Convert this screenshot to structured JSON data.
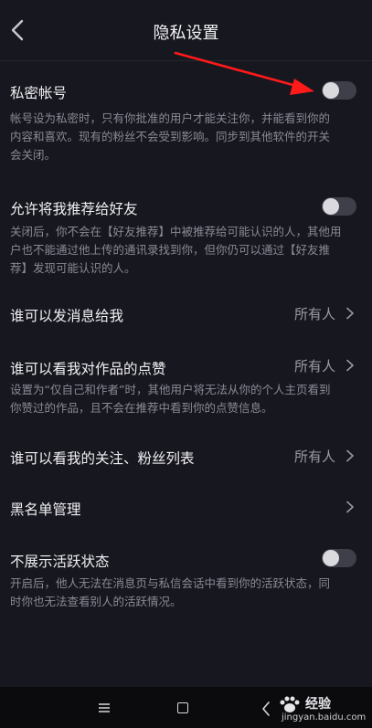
{
  "header": {
    "title": "隐私设置"
  },
  "settings": {
    "private_account": {
      "label": "私密帐号",
      "on": false,
      "desc_lines": [
        "帐号设为私密时，只有你批准的用户才能关注你，并能看到你的",
        "内容和喜欢。现有的粉丝不会受到影响。同步到其他软件的开关",
        "会关闭。"
      ]
    },
    "recommend_to_friends": {
      "label": "允许将我推荐给好友",
      "on": false,
      "desc_lines": [
        "关闭后，你不会在【好友推荐】中被推荐给可能认识的人，其他用",
        "户也不能通过他上传的通讯录找到你，但你仍可以通过【好友推",
        "荐】发现可能认识的人。"
      ]
    },
    "who_can_message": {
      "label": "谁可以发消息给我",
      "value": "所有人"
    },
    "who_can_see_likes": {
      "label": "谁可以看我对作品的点赞",
      "value": "所有人",
      "desc_lines": [
        "设置为“仅自己和作者”时，其他用户将无法从你的个人主页看到",
        "你赞过的作品，且不会在推荐中看到你的点赞信息。"
      ]
    },
    "who_can_see_follows": {
      "label": "谁可以看我的关注、粉丝列表",
      "value": "所有人"
    },
    "blacklist": {
      "label": "黑名单管理"
    },
    "hide_activity_status": {
      "label": "不展示活跃状态",
      "on": false,
      "desc_lines": [
        "开启后，他人无法在消息页与私信会话中看到你的活跃状态，同",
        "时你也无法查看别人的活跃情况。"
      ]
    }
  },
  "watermark": {
    "title": "经验",
    "url": "jingyan.baidu.com"
  },
  "colors": {
    "background": "#17171f",
    "annotation_arrow": "#ff1a1a",
    "toggle_off_track": "#3f3f4a",
    "toggle_knob": "#d9d9de"
  }
}
